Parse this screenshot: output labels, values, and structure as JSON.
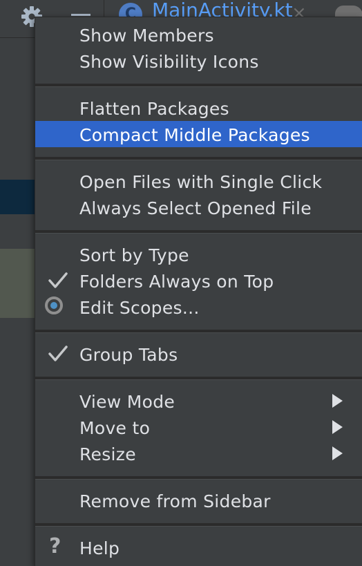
{
  "background": {
    "editor_tab_title": "MainActivity.kt",
    "editor_tab_icon_letter": "C"
  },
  "menu": {
    "items": [
      {
        "label": "Show Members"
      },
      {
        "label": "Show Visibility Icons"
      },
      {
        "label": "Flatten Packages"
      },
      {
        "label": "Compact Middle Packages",
        "selected": true
      },
      {
        "label": "Open Files with Single Click"
      },
      {
        "label": "Always Select Opened File"
      },
      {
        "label": "Sort by Type"
      },
      {
        "label": "Folders Always on Top",
        "checked": true
      },
      {
        "label": "Edit Scopes...",
        "radio": true
      },
      {
        "label": "Group Tabs",
        "checked": true
      },
      {
        "label": "View Mode",
        "submenu": true
      },
      {
        "label": "Move to",
        "submenu": true
      },
      {
        "label": "Resize",
        "submenu": true
      },
      {
        "label": "Remove from Sidebar"
      },
      {
        "label": "Help",
        "icon": "question-icon"
      }
    ],
    "help_glyph": "?",
    "colors": {
      "menu_bg": "#3c3f41",
      "selection": "#2f65ca",
      "text": "#dfe1e5",
      "separator": "#2b2b2b"
    }
  }
}
